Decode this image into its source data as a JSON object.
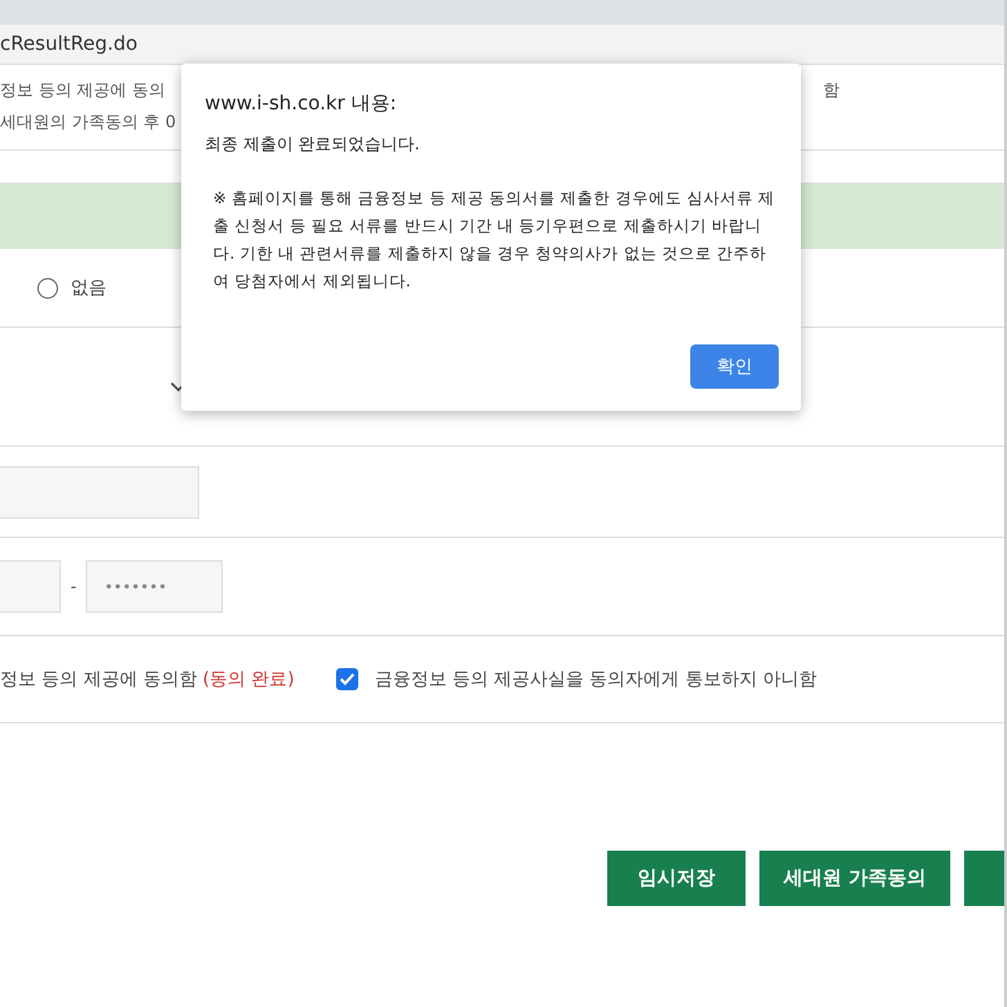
{
  "address_bar": {
    "url": "cResultReg.do"
  },
  "notice": {
    "line_1": "정보 등의 제공에 동의",
    "line_1_end": "함",
    "line_2": "세대원의 가족동의 후 0"
  },
  "radio": {
    "label": "없음",
    "selected": false
  },
  "id_fields": {
    "separator": "-",
    "field_2_value": "•••••••"
  },
  "consents": [
    {
      "label": "정보 등의 제공에 동의함",
      "status": "(동의 완료)"
    },
    {
      "label": "금융정보 등의 제공사실을 동의자에게 통보하지 아니함",
      "checked": true
    }
  ],
  "buttons": [
    "임시저장",
    "세대원 가족동의"
  ],
  "dialog": {
    "title": "www.i-sh.co.kr 내용:",
    "message": "최종 제출이 완료되었습니다.",
    "note": "※ 홈페이지를 통해 금융정보 등 제공 동의서를 제출한 경우에도 심사서류 제출 신청서 등 필요 서류를 반드시 기간 내 등기우편으로 제출하시기 바랍니다. 기한 내 관련서류를 제출하지 않을 경우 청약의사가 없는 것으로 간주하여 당첨자에서 제외됩니다.",
    "ok": "확인"
  }
}
